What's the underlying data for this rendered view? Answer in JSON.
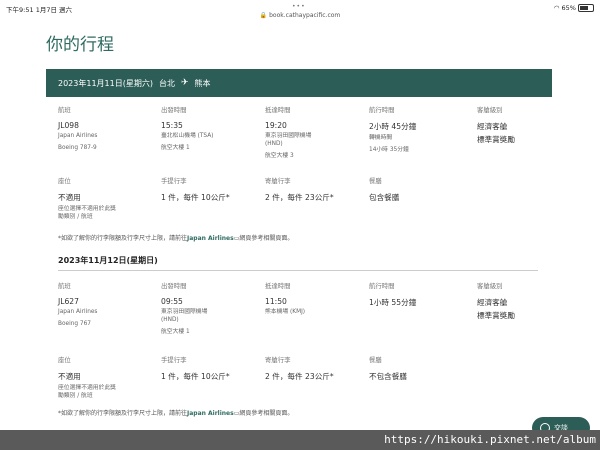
{
  "status": {
    "time": "下午9:51",
    "date": "1月7日 週六",
    "url": "book.cathaypacific.com",
    "dots": "•••",
    "battery": "65%"
  },
  "page_title": "你的行程",
  "flights": [
    {
      "header_date": "2023年11月11日(星期六)",
      "from": "台北",
      "to": "熊本",
      "flight": {
        "label": "航班",
        "number": "JL098",
        "airline": "Japan Airlines",
        "aircraft": "Boeing 787-9"
      },
      "depart": {
        "label": "出發時間",
        "time": "15:35",
        "airport": "臺北松山機場 (TSA)",
        "terminal": "航空大樓 1"
      },
      "arrive": {
        "label": "抵達時間",
        "time": "19:20",
        "airport": "東京羽田國際機場",
        "airport2": "(HND)",
        "terminal": "航空大樓 3"
      },
      "duration": {
        "label": "航行時間",
        "value": "2小時 45分鐘",
        "transfer_label": "轉機時間",
        "transfer": "14小時 35分鐘"
      },
      "cabin": {
        "label": "客艙級別",
        "value": "經濟客艙",
        "fare": "標準賞獎勵"
      },
      "seat": {
        "label": "座位",
        "value": "不適用",
        "note1": "座位選擇不適用於此獎",
        "note2": "勵類別 / 航班"
      },
      "carry": {
        "label": "手提行李",
        "value": "1 件，每件 10公斤*"
      },
      "checked": {
        "label": "寄艙行李",
        "value": "2 件，每件 23公斤*"
      },
      "meal": {
        "label": "餐膳",
        "value": "包含餐膳"
      },
      "note": {
        "pre": "*如欲了解你的行李限額及行李尺寸上限，請前往",
        "link": "Japan Airlines",
        "post": "網頁參考相關頁面。"
      }
    },
    {
      "header_date": "2023年11月12日(星期日)",
      "flight": {
        "label": "航班",
        "number": "JL627",
        "airline": "Japan Airlines",
        "aircraft": "Boeing 767"
      },
      "depart": {
        "label": "出發時間",
        "time": "09:55",
        "airport": "東京羽田國際機場",
        "airport2": "(HND)",
        "terminal": "航空大樓 1"
      },
      "arrive": {
        "label": "抵達時間",
        "time": "11:50",
        "airport": "熊本機場 (KMJ)"
      },
      "duration": {
        "label": "航行時間",
        "value": "1小時 55分鐘"
      },
      "cabin": {
        "label": "客艙級別",
        "value": "經濟客艙",
        "fare": "標準賞獎勵"
      },
      "seat": {
        "label": "座位",
        "value": "不適用",
        "note1": "座位選擇不適用於此獎",
        "note2": "勵類別 / 航班"
      },
      "carry": {
        "label": "手提行李",
        "value": "1 件，每件 10公斤*"
      },
      "checked": {
        "label": "寄艙行李",
        "value": "2 件，每件 23公斤*"
      },
      "meal": {
        "label": "餐膳",
        "value": "不包含餐膳"
      },
      "note": {
        "pre": "*如欲了解你的行李限額及行李尺寸上限，請前往",
        "link": "Japan Airlines",
        "post": "網頁參考相關頁面。"
      }
    }
  ],
  "chat_label": "交談",
  "watermark": "https://hikouki.pixnet.net/album"
}
